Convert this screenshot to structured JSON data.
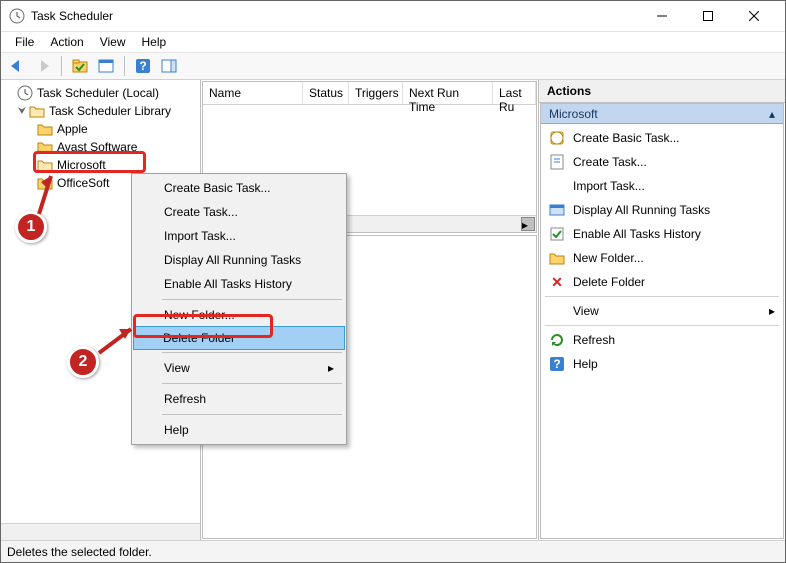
{
  "window": {
    "title": "Task Scheduler"
  },
  "menu": {
    "file": "File",
    "action": "Action",
    "view": "View",
    "help": "Help"
  },
  "tree": {
    "root": "Task Scheduler (Local)",
    "library": "Task Scheduler Library",
    "items": [
      "Apple",
      "Avast Software",
      "Microsoft",
      "OfficeSoft"
    ]
  },
  "columns": {
    "name": "Name",
    "status": "Status",
    "triggers": "Triggers",
    "next": "Next Run Time",
    "last": "Last Ru"
  },
  "actions": {
    "header": "Actions",
    "sub": "Microsoft",
    "items": [
      {
        "label": "Create Basic Task...",
        "icon": "clock"
      },
      {
        "label": "Create Task...",
        "icon": "task"
      },
      {
        "label": "Import Task...",
        "icon": ""
      },
      {
        "label": "Display All Running Tasks",
        "icon": "running"
      },
      {
        "label": "Enable All Tasks History",
        "icon": "enable"
      },
      {
        "label": "New Folder...",
        "icon": "folder"
      },
      {
        "label": "Delete Folder",
        "icon": "delete"
      }
    ],
    "view": "View",
    "refresh": "Refresh",
    "help": "Help"
  },
  "ctx": {
    "items0": [
      "Create Basic Task...",
      "Create Task...",
      "Import Task...",
      "Display All Running Tasks",
      "Enable All Tasks History"
    ],
    "items1": [
      "New Folder...",
      "Delete Folder"
    ],
    "view": "View",
    "refresh": "Refresh",
    "help": "Help"
  },
  "status": "Deletes the selected folder."
}
